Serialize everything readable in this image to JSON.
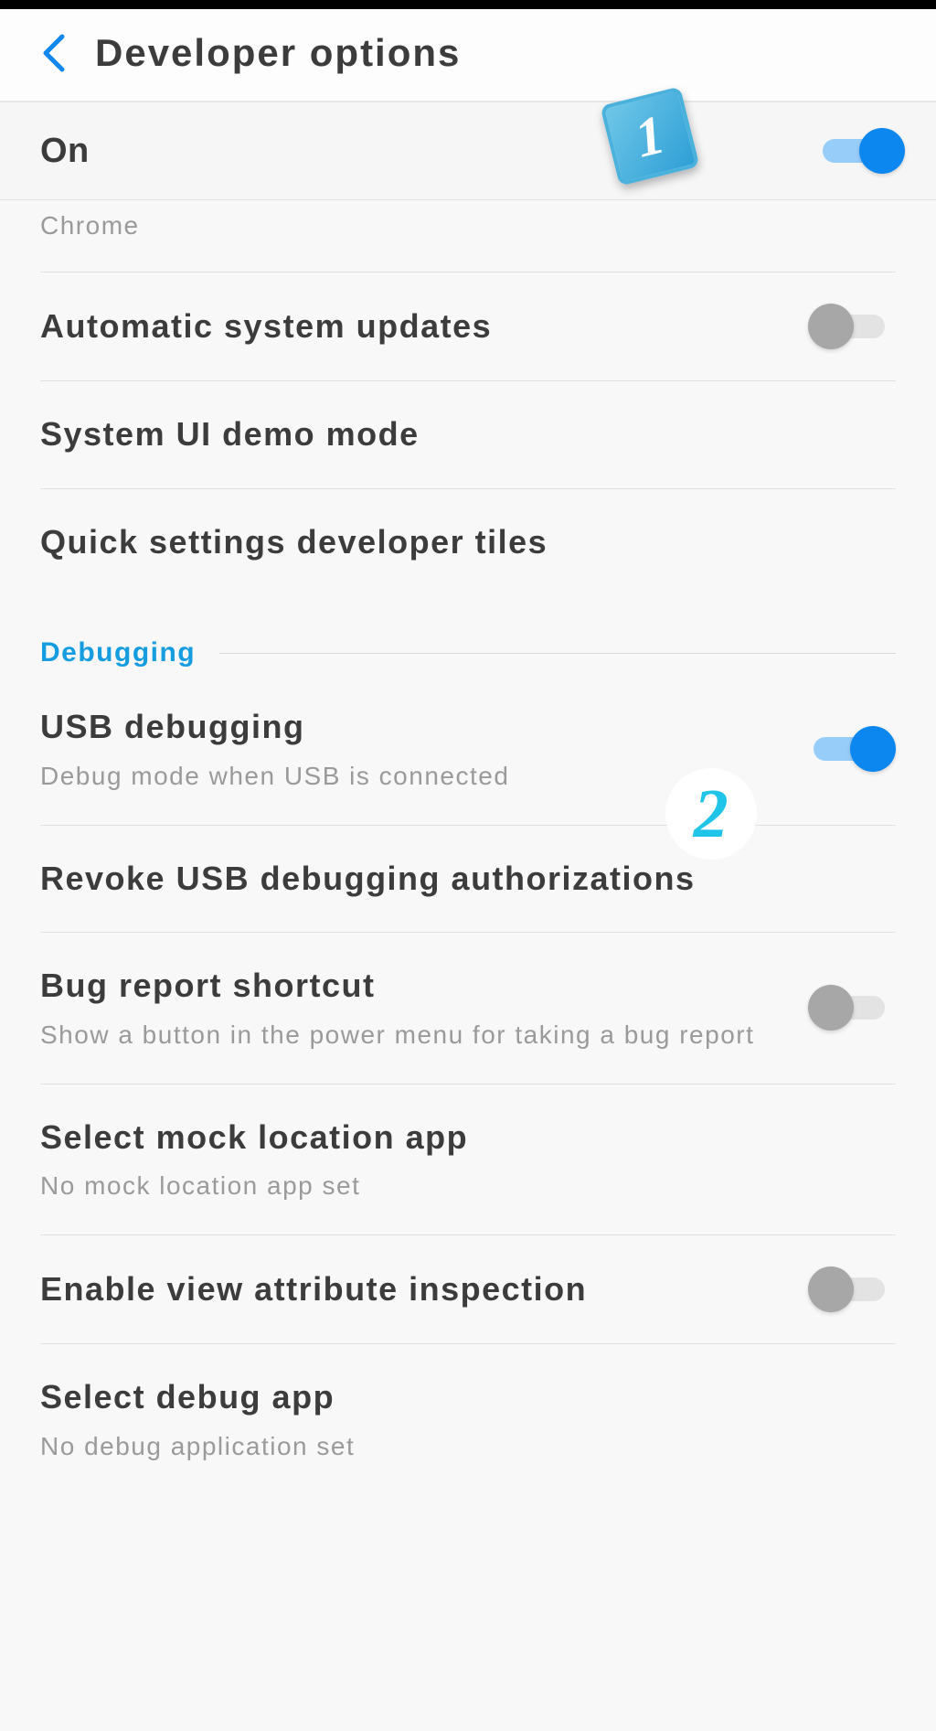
{
  "header": {
    "title": "Developer options"
  },
  "master": {
    "label": "On",
    "state": "on"
  },
  "partial_row": {
    "subtitle": "Chrome"
  },
  "rows": [
    {
      "title": "Automatic system updates",
      "toggle": "off"
    },
    {
      "title": "System UI demo mode"
    },
    {
      "title": "Quick settings developer tiles"
    }
  ],
  "section": {
    "label": "Debugging"
  },
  "debug_rows": [
    {
      "title": "USB debugging",
      "subtitle": "Debug mode when USB is connected",
      "toggle": "on"
    },
    {
      "title": "Revoke USB debugging authorizations"
    },
    {
      "title": "Bug report shortcut",
      "subtitle": "Show a button in the power menu for taking a bug report",
      "toggle": "off"
    },
    {
      "title": "Select mock location app",
      "subtitle": "No mock location app set"
    },
    {
      "title": "Enable view attribute inspection",
      "toggle": "off"
    },
    {
      "title": "Select debug app",
      "subtitle": "No debug application set"
    }
  ],
  "annotations": {
    "badge1": "1",
    "badge2": "2"
  }
}
